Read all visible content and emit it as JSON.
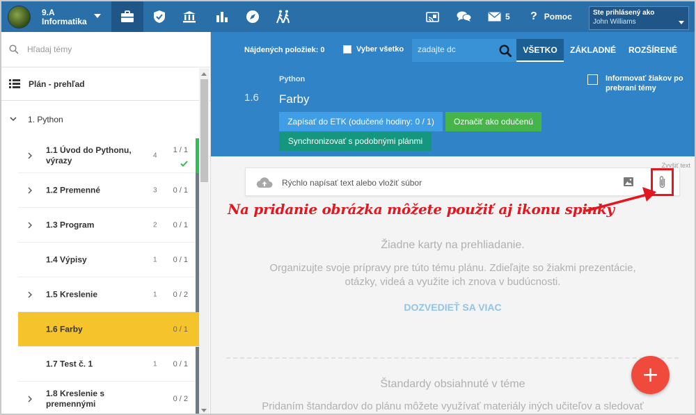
{
  "header": {
    "class_line1": "9.A",
    "class_line2": "Informatika",
    "nav_icons": [
      "briefcase-icon",
      "shield-icon",
      "bank-icon",
      "bar-chart-icon",
      "compass-icon",
      "hikers-icon"
    ],
    "cast_icon": "cast-icon",
    "chat_icon": "chat-icon",
    "mail_count": "5",
    "help_label": "Pomoc",
    "user_label": "Ste prihlásený ako",
    "user_name": "John Williams"
  },
  "sidebar": {
    "search_placeholder": "Hľadaj témy",
    "plan_label": "Plán - prehľad",
    "section_label": "1. Python",
    "items": [
      {
        "title": "1.1  Úvod do Pythonu, výrazy",
        "count": "4",
        "progress": "1 / 1",
        "done": true
      },
      {
        "title": "1.2  Premenné",
        "count": "3",
        "progress": "0 / 1"
      },
      {
        "title": "1.3  Program",
        "count": "2",
        "progress": "0 / 1"
      },
      {
        "title": "1.4  Výpisy",
        "count": "1",
        "progress": "0 / 1"
      },
      {
        "title": "1.5  Kreslenie",
        "count": "1",
        "progress": "0 / 2"
      },
      {
        "title": "1.6  Farby",
        "count": "",
        "progress": "0 / 1",
        "active": true
      },
      {
        "title": "1.7  Test č. 1",
        "count": "1",
        "progress": "0 / 1"
      },
      {
        "title": "1.8  Kreslenie s premennými",
        "count": "",
        "progress": "0 / 2"
      }
    ]
  },
  "main": {
    "found_label": "Nájdených položiek: 0",
    "select_all": "Vyber všetko",
    "search_placeholder": "zadajte dc",
    "tabs": [
      "VŠETKO",
      "ZÁKLADNÉ",
      "ROZŠÍRENÉ"
    ],
    "topic_category": "Python",
    "topic_number": "1.6",
    "topic_title": "Farby",
    "notify_label": "Informovať žiakov po prebraní témy",
    "btn_etk": "Zapísať do ETK (odučené hodiny: 0 / 1)",
    "btn_mark": "Označiť ako odučenú",
    "btn_sync": "Synchronizovať s podobnými plánmi"
  },
  "content": {
    "collapse_label": "Zvyšiť text",
    "quick_placeholder": "Rýchlo napísať text alebo vložiť súbor",
    "annotation": "Na pridanie obrázka môžete použiť aj ikonu spinky",
    "empty_title": "Žiadne karty na prehliadanie.",
    "empty_text": "Organizujte svoje prípravy pre túto tému plánu. Zdieľajte so žiakmi prezentácie, otázky, videá a využite ich znova v budúcnosti.",
    "learn_more": "DOZVEDIEŤ SA VIAC",
    "standards_title": "Štandardy obsiahnuté v téme",
    "standards_text": "Pridaním štandardov do plánu môžete využívať materiály iných učiteľov a sledovať",
    "fab_label": "+"
  },
  "colors": {
    "header_bg": "#2b6fa8",
    "main_header_bg": "#2f83c6",
    "active_item": "#f5c42c",
    "annotation_red": "#e4161f",
    "fab": "#f04a3c"
  }
}
